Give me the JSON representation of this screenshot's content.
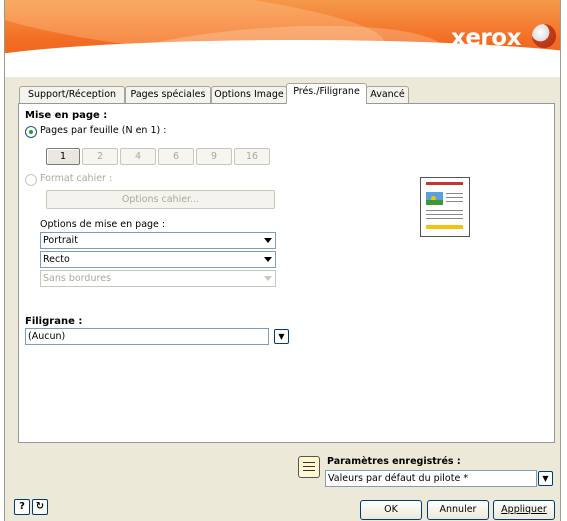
{
  "brand": {
    "logo_text": "xerox"
  },
  "tabs": [
    {
      "label": "Support/Réception"
    },
    {
      "label": "Pages spéciales"
    },
    {
      "label": "Options Image"
    },
    {
      "label": "Prés./Filigrane"
    },
    {
      "label": "Avancé"
    }
  ],
  "layout": {
    "section_title": "Mise en page :",
    "pages_per_sheet_label": "Pages par feuille (N en 1) :",
    "pages_per_sheet_options": [
      "1",
      "2",
      "4",
      "6",
      "9",
      "16"
    ],
    "pages_per_sheet_selected": "1",
    "booklet_label": "Format cahier :",
    "booklet_options_button": "Options cahier...",
    "layout_options_label": "Options de mise en page :",
    "orientation_value": "Portrait",
    "sides_value": "Recto",
    "borders_value": "Sans bordures"
  },
  "watermark": {
    "title": "Filigrane :",
    "value": "(Aucun)"
  },
  "saved_settings": {
    "title": "Paramètres enregistrés :",
    "value": "Valeurs par défaut du pilote *"
  },
  "footer": {
    "help_label": "?",
    "ok_label": "OK",
    "cancel_label": "Annuler",
    "apply_label": "Appliquer"
  }
}
